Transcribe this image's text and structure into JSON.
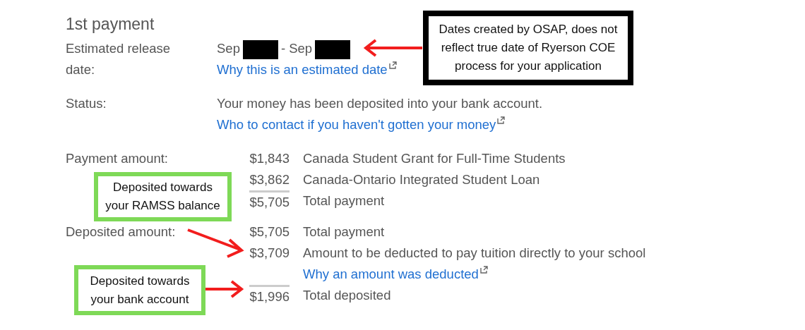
{
  "heading": "1st payment",
  "release": {
    "label": "Estimated release date:",
    "parts": [
      {
        "kind": "text",
        "text": "Sep"
      },
      {
        "kind": "redacted"
      },
      {
        "kind": "text",
        "text": "- Sep"
      },
      {
        "kind": "redacted"
      }
    ],
    "link": "Why this is an estimated date"
  },
  "status": {
    "label": "Status:",
    "text": "Your money has been deposited into your bank account.",
    "link": "Who to contact if you haven't gotten your money"
  },
  "payment": {
    "label": "Payment amount:",
    "rows": [
      {
        "kind": "line",
        "amount": "$1,843",
        "text": "Canada Student Grant for Full-Time Students",
        "total": false
      },
      {
        "kind": "line",
        "amount": "$3,862",
        "text": "Canada-Ontario Integrated Student Loan",
        "total": false
      },
      {
        "kind": "line",
        "amount": "$5,705",
        "text": "Total payment",
        "total": true
      }
    ]
  },
  "deposited": {
    "label": "Deposited amount:",
    "rows": [
      {
        "kind": "line",
        "amount": "$5,705",
        "text": "Total payment",
        "total": false
      },
      {
        "kind": "line",
        "amount": "$3,709",
        "text": "Amount to be deducted to pay tuition directly to your school",
        "total": false
      },
      {
        "kind": "link",
        "text": "Why an amount was deducted"
      },
      {
        "kind": "line",
        "amount": "$1,996",
        "text": "Total deposited",
        "total": true
      }
    ]
  },
  "annotations": [
    {
      "text": "Dates created by OSAP, does not reflect true date of Ryerson COE process for your application",
      "color": "#000000"
    },
    {
      "text": "Deposited towards your RAMSS balance",
      "color": "#7ed957"
    },
    {
      "text": "Deposited towards your bank account",
      "color": "#7ed957"
    }
  ]
}
